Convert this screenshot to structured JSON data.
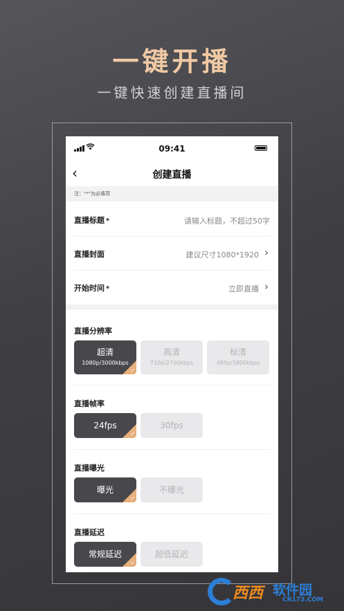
{
  "promo": {
    "title": "一键开播",
    "subtitle": "一键快速创建直播间"
  },
  "status_bar": {
    "time": "09:41",
    "icons": [
      "signal-icon",
      "wifi-icon",
      "battery-icon"
    ]
  },
  "nav": {
    "back_icon": "‹",
    "title": "创建直播"
  },
  "note": "注：\"*\"为必填项",
  "form": {
    "title_label": "直播标题",
    "title_required": "*",
    "title_placeholder": "请输入标题，不超过50字",
    "cover_label": "直播封面",
    "cover_value": "建议尺寸1080*1920",
    "time_label": "开始时间",
    "time_required": "*",
    "time_value": "立即直播",
    "chevron": "›"
  },
  "resolution": {
    "title": "直播分辨率",
    "options": [
      {
        "label": "超清",
        "sub": "1080p/3000kbps",
        "selected": true
      },
      {
        "label": "高清",
        "sub": "720p/2700kbps",
        "selected": false
      },
      {
        "label": "标清",
        "sub": "480p/3800kbps",
        "selected": false
      }
    ]
  },
  "framerate": {
    "title": "直播帧率",
    "options": [
      {
        "label": "24fps",
        "selected": true
      },
      {
        "label": "30fps",
        "selected": false
      }
    ]
  },
  "exposure": {
    "title": "直播曝光",
    "options": [
      {
        "label": "曝光",
        "selected": true
      },
      {
        "label": "不曝光",
        "selected": false
      }
    ]
  },
  "latency": {
    "title": "直播延迟",
    "options": [
      {
        "label": "常规延迟",
        "selected": true
      },
      {
        "label": "超低延迟",
        "selected": false
      }
    ]
  },
  "check_mark": "✓",
  "watermark": {
    "text1": "西西",
    "text2": "软件园",
    "url": "CR173.COM"
  },
  "colors": {
    "accent": "#f0c9a4",
    "selected_bg": "#48484c",
    "badge": "#e7b07d"
  }
}
